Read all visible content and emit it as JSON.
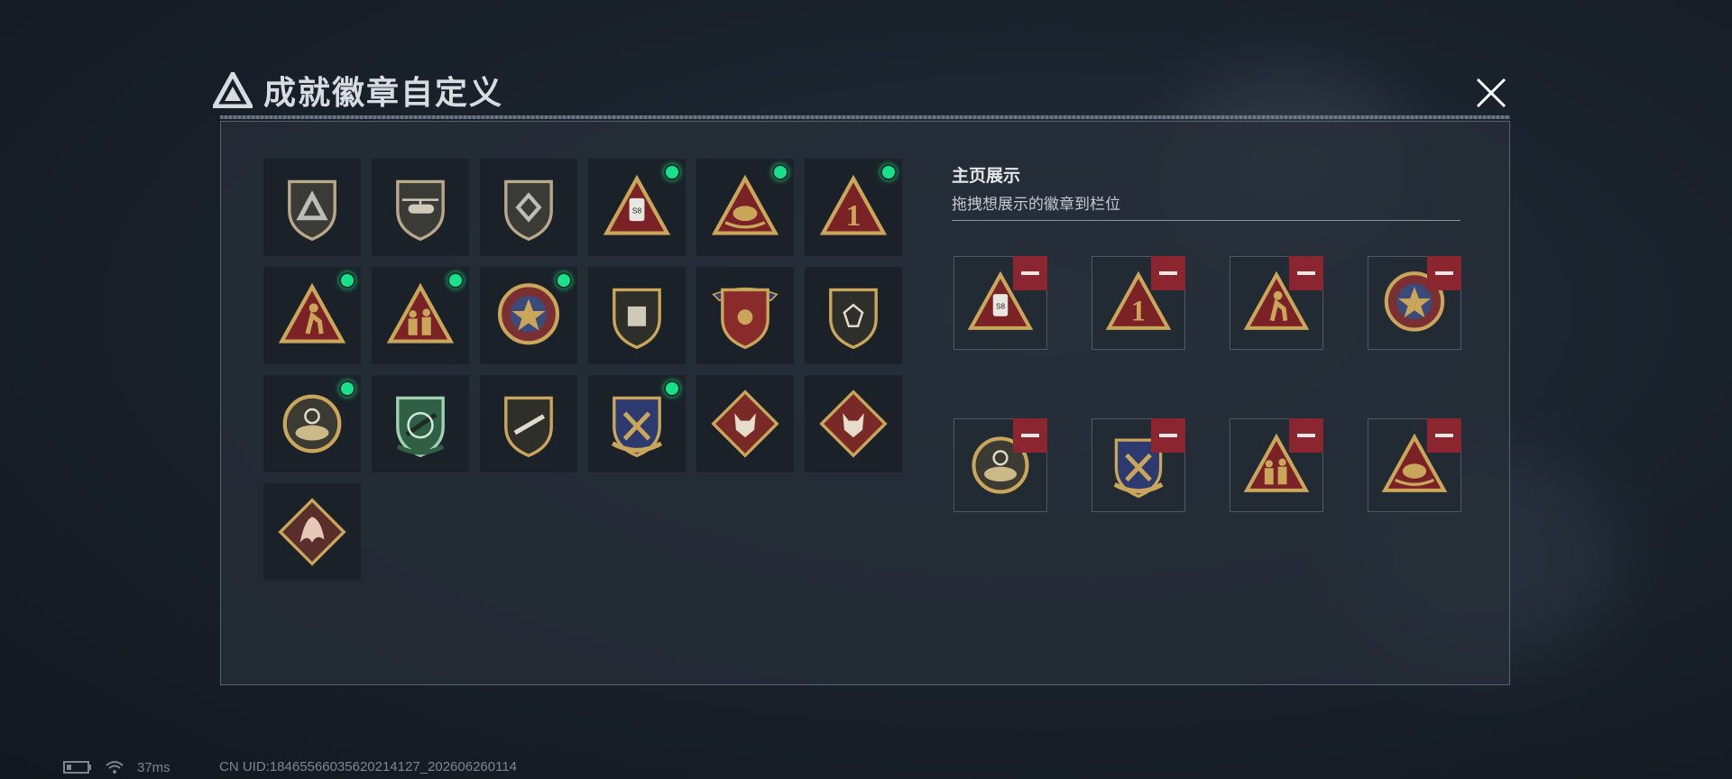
{
  "window": {
    "title": "成就徽章自定义",
    "close_icon": "close-icon"
  },
  "badge_grid": {
    "items": [
      {
        "icon": "triangle-logo-shield-badge",
        "equipped": false
      },
      {
        "icon": "helicopter-shield-badge",
        "equipped": false
      },
      {
        "icon": "diamond-emblem-shield-badge",
        "equipped": false
      },
      {
        "icon": "s8-armor-triangle-badge",
        "equipped": true
      },
      {
        "icon": "egg-nest-triangle-badge",
        "equipped": true
      },
      {
        "icon": "number-one-triangle-badge",
        "equipped": true
      },
      {
        "icon": "running-soldier-triangle-badge",
        "equipped": true
      },
      {
        "icon": "squad-soldiers-triangle-badge",
        "equipped": true
      },
      {
        "icon": "star-medal-badge",
        "equipped": true
      },
      {
        "icon": "crest-shield-badge",
        "equipped": false
      },
      {
        "icon": "winged-stars-shield-badge",
        "equipped": false
      },
      {
        "icon": "gem-shield-badge",
        "equipped": false
      },
      {
        "icon": "target-medallion-badge",
        "equipped": true
      },
      {
        "icon": "green-rifle-shield-badge",
        "equipped": false
      },
      {
        "icon": "rifle-shield-badge",
        "equipped": false
      },
      {
        "icon": "crossed-weapons-shield-badge",
        "equipped": true
      },
      {
        "icon": "wolf-diamond-badge",
        "equipped": false
      },
      {
        "icon": "wolf-diamond-badge",
        "equipped": false
      },
      {
        "icon": "dragon-diamond-badge",
        "equipped": false
      }
    ]
  },
  "showcase": {
    "title": "主页展示",
    "subtitle": "拖拽想展示的徽章到栏位",
    "remove_icon": "minus-icon",
    "slots": [
      {
        "icon": "s8-armor-triangle-badge"
      },
      {
        "icon": "number-one-triangle-badge"
      },
      {
        "icon": "running-soldier-triangle-badge"
      },
      {
        "icon": "star-medal-badge"
      },
      {
        "icon": "target-medallion-badge"
      },
      {
        "icon": "crossed-weapons-shield-badge"
      },
      {
        "icon": "squad-soldiers-triangle-badge"
      },
      {
        "icon": "egg-nest-triangle-badge"
      }
    ]
  },
  "status_bar": {
    "battery_icon": "battery-icon",
    "wifi_icon": "wifi-icon",
    "ping": "37ms",
    "uid": "CN UID:18465566035620214127_202606260114"
  },
  "colors": {
    "equipped_dot": "#19e08a",
    "remove_button": "#8b2530",
    "gold": "#c9a65a"
  }
}
